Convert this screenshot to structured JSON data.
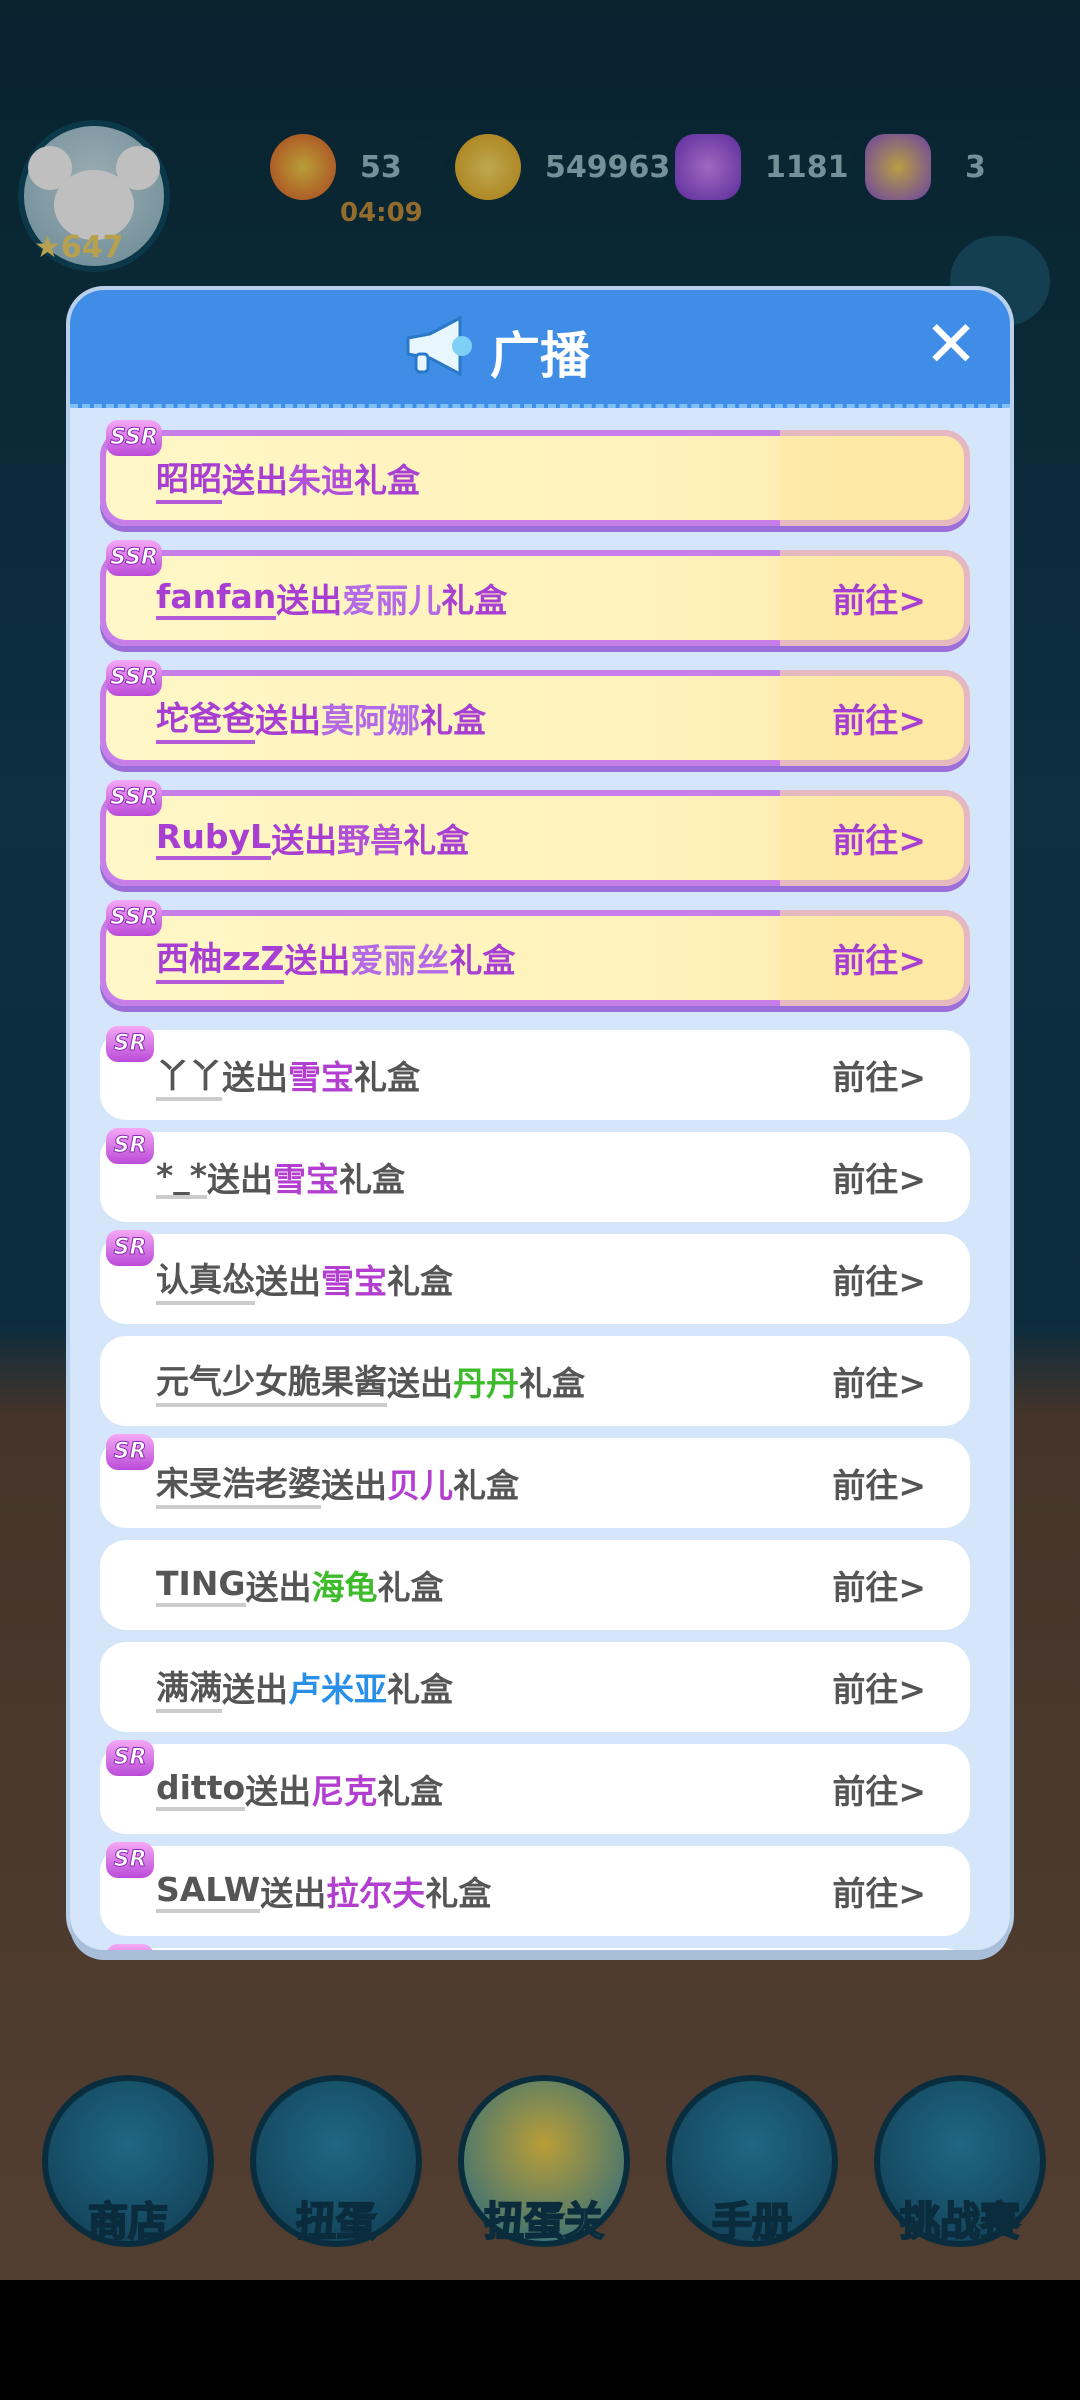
{
  "hud": {
    "level": "647",
    "energy": "53",
    "energy_timer": "04:09",
    "coins": "549963",
    "gems": "1181",
    "crowns": "3"
  },
  "dialog": {
    "title": "广播",
    "close_label": "✕"
  },
  "go_label": "前往>",
  "rows": [
    {
      "tier": "ssr",
      "name": "昭昭",
      "verb": "送出",
      "item": "朱迪",
      "suffix": "礼盒",
      "item_color": "#b14fd9",
      "show_go": false
    },
    {
      "tier": "ssr",
      "name": "fanfan",
      "verb": "送出",
      "item": "爱丽儿",
      "suffix": "礼盒",
      "item_color": "#b46ae6",
      "show_go": true
    },
    {
      "tier": "ssr",
      "name": "坨爸爸",
      "verb": "送出",
      "item": "莫阿娜",
      "suffix": "礼盒",
      "item_color": "#b46ae6",
      "show_go": true
    },
    {
      "tier": "ssr",
      "name": "RubyL",
      "verb": "送出",
      "item": "野兽",
      "suffix": "礼盒",
      "item_color": "#b14fd9",
      "show_go": true
    },
    {
      "tier": "ssr",
      "name": "西柚zzZ",
      "verb": "送出",
      "item": "爱丽丝",
      "suffix": "礼盒",
      "item_color": "#b46ae6",
      "show_go": true
    },
    {
      "tier": "sr",
      "name": "丫丫",
      "verb": "送出",
      "item": "雪宝",
      "suffix": "礼盒",
      "item_color": "#b23fcf",
      "show_go": true
    },
    {
      "tier": "sr",
      "name": "*_*",
      "verb": "送出",
      "item": "雪宝",
      "suffix": "礼盒",
      "item_color": "#b23fcf",
      "show_go": true
    },
    {
      "tier": "sr",
      "name": "认真怂",
      "verb": "送出",
      "item": "雪宝",
      "suffix": "礼盒",
      "item_color": "#b23fcf",
      "show_go": true
    },
    {
      "tier": "r",
      "name": "元气少女脆果酱",
      "verb": "送出",
      "item": "丹丹",
      "suffix": "礼盒",
      "item_color": "#3dbb2b",
      "show_go": true
    },
    {
      "tier": "sr",
      "name": "宋旻浩老婆",
      "verb": "送出",
      "item": "贝儿",
      "suffix": "礼盒",
      "item_color": "#b23fcf",
      "show_go": true
    },
    {
      "tier": "r",
      "name": "TING",
      "verb": "送出",
      "item": "海龟",
      "suffix": "礼盒",
      "item_color": "#3dbb2b",
      "show_go": true
    },
    {
      "tier": "r",
      "name": "满满",
      "verb": "送出",
      "item": "卢米亚",
      "suffix": "礼盒",
      "item_color": "#2a8fe6",
      "show_go": true
    },
    {
      "tier": "sr",
      "name": "ditto",
      "verb": "送出",
      "item": "尼克",
      "suffix": "礼盒",
      "item_color": "#b23fcf",
      "show_go": true
    },
    {
      "tier": "sr",
      "name": "SALW",
      "verb": "送出",
      "item": "拉尔夫",
      "suffix": "礼盒",
      "item_color": "#b23fcf",
      "show_go": true
    }
  ],
  "badges": {
    "ssr": "SSR",
    "sr": "SR"
  },
  "nav": [
    {
      "label": "商店"
    },
    {
      "label": "扭蛋"
    },
    {
      "label": "扭蛋关"
    },
    {
      "label": "手册"
    },
    {
      "label": "挑战赛"
    }
  ]
}
